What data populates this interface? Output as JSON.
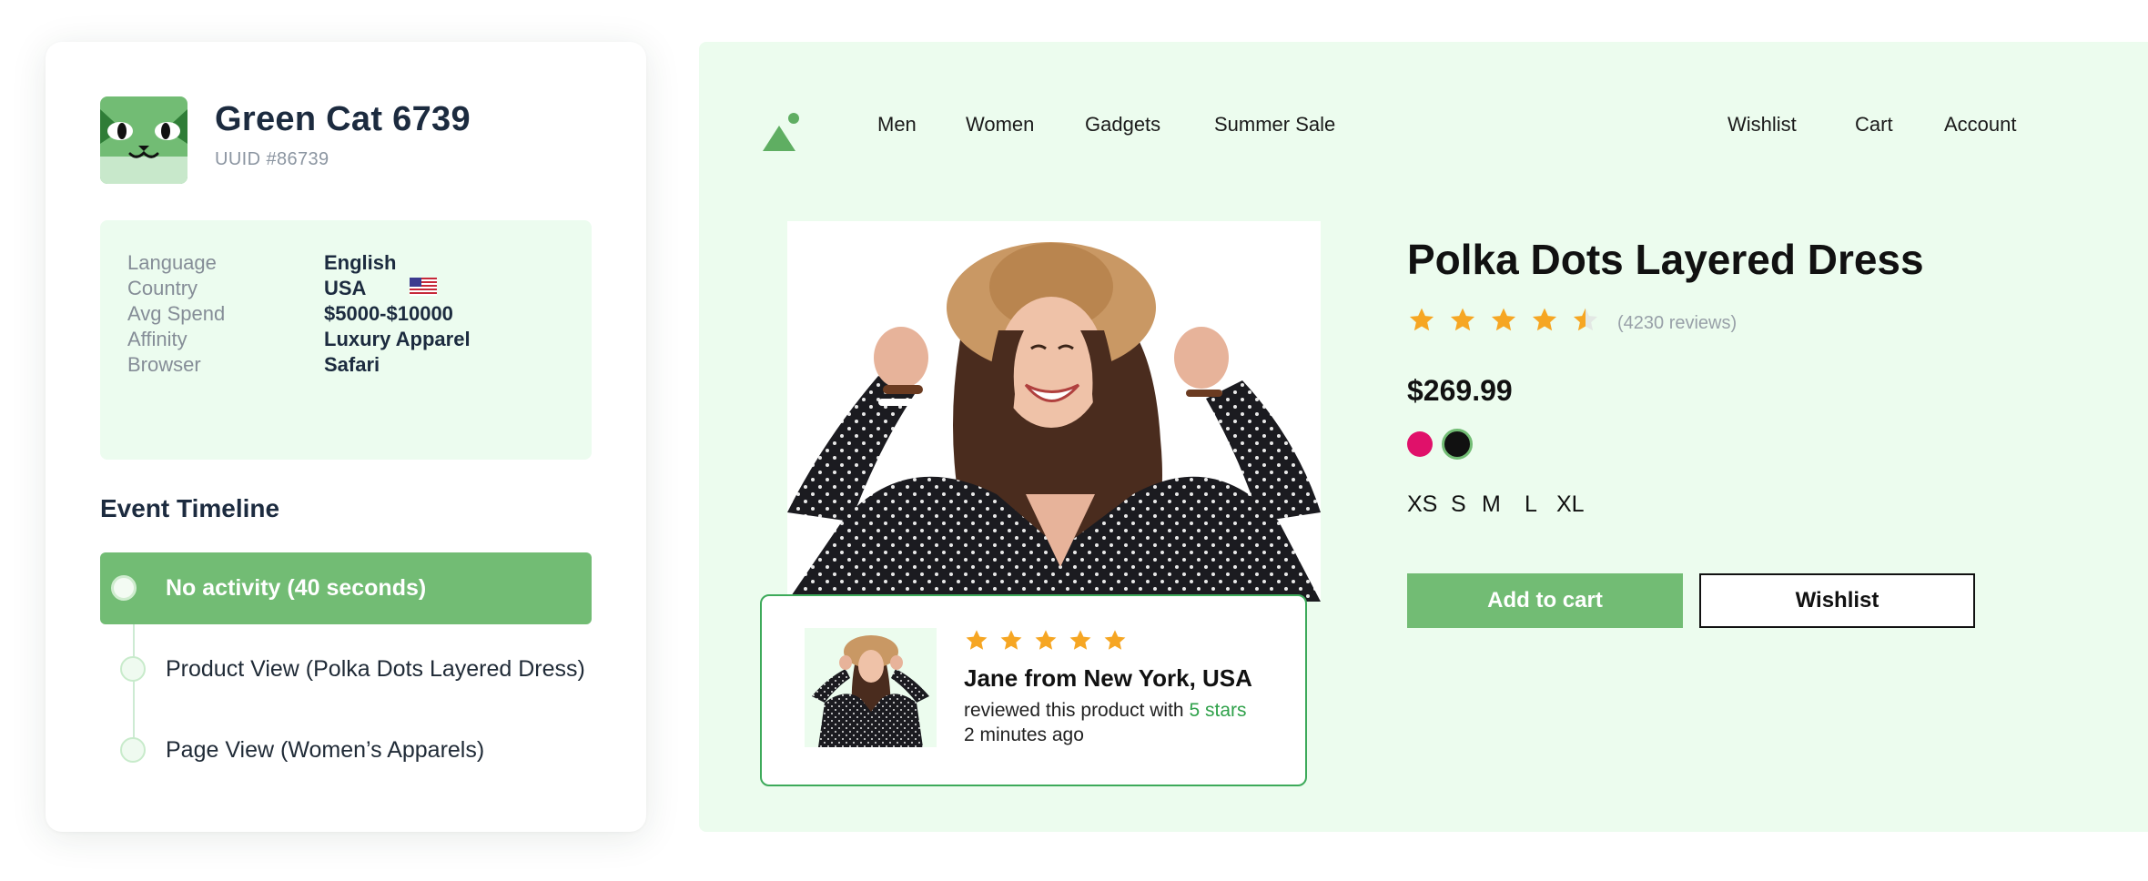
{
  "profile": {
    "name": "Green Cat 6739",
    "uuid": "UUID #86739",
    "attributes": [
      {
        "key": "Language",
        "value": "English"
      },
      {
        "key": "Country",
        "value": "USA"
      },
      {
        "key": "Avg Spend",
        "value": "$5000-$10000"
      },
      {
        "key": "Affinity",
        "value": "Luxury Apparel"
      },
      {
        "key": "Browser",
        "value": "Safari"
      }
    ],
    "country_flag_icon": "us-flag-icon"
  },
  "timeline": {
    "title": "Event Timeline",
    "events": [
      {
        "label": "No activity (40 seconds)",
        "active": true
      },
      {
        "label": "Product View (Polka Dots Layered Dress)",
        "active": false
      },
      {
        "label": "Page View (Women’s Apparels)",
        "active": false
      }
    ]
  },
  "store": {
    "nav_left": [
      "Men",
      "Women",
      "Gadgets",
      "Summer Sale"
    ],
    "nav_right": [
      "Wishlist",
      "Cart",
      "Account"
    ],
    "product": {
      "title": "Polka Dots Layered Dress",
      "rating": 4.5,
      "reviews": "(4230 reviews)",
      "price": "$269.99",
      "colors": [
        "#e0116a",
        "#111111"
      ],
      "selected_color": "#111111",
      "sizes": [
        "XS",
        "S",
        "M",
        "L",
        "XL"
      ],
      "add_to_cart": "Add to cart",
      "wishlist": "Wishlist"
    },
    "review": {
      "stars": 5,
      "name": "Jane from New York, USA",
      "text": "reviewed this product with",
      "highlight": "5 stars",
      "time": "2 minutes ago"
    }
  },
  "colors": {
    "accent_green": "#72bc74",
    "mint_bg": "#ecfcee",
    "star": "#f6a623",
    "review_border": "#3daa5a"
  }
}
